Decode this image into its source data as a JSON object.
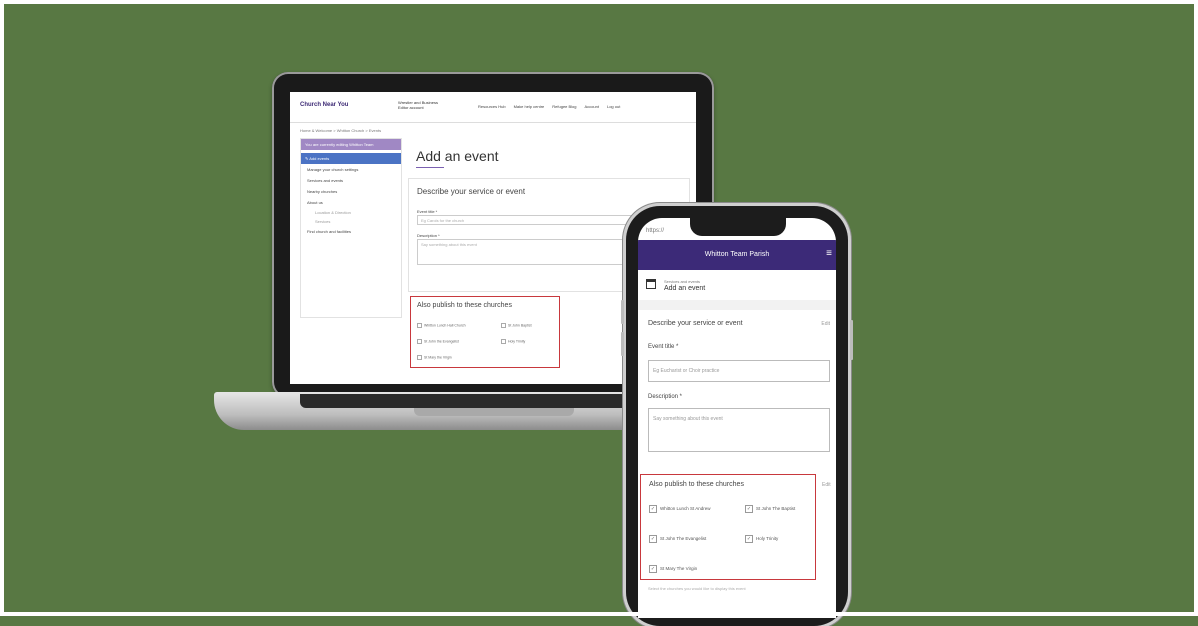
{
  "laptop": {
    "header": {
      "logo": "Church Near You",
      "church_line1": "Wrestler and Business",
      "church_line2": "Editor account",
      "nav": [
        "Resources Hub",
        "Make help centre",
        "Refugee Blog",
        "Account",
        "Log out"
      ]
    },
    "breadcrumb": "Home & Welcome > Whitton Church > Events",
    "sidebar": {
      "header": "You are currently editing Whitton Team",
      "active": "Add events",
      "items": [
        "Manage your church settings",
        "Services and events",
        "Nearby churches",
        "About us"
      ],
      "subitems": [
        "Location & Direction",
        "Services"
      ],
      "last": "Find church and facilities"
    },
    "page_title": "Add an event",
    "card": {
      "title": "Describe your service or event",
      "event_title_label": "Event title *",
      "event_title_placeholder": "Eg Carols for the church",
      "description_label": "Description *",
      "description_placeholder": "Say something about this event"
    },
    "publish": {
      "title": "Also publish to these churches",
      "churches": [
        "Whitton Lunch Hall Church",
        "St John Baptist",
        "St John the Evangelist",
        "Holy Trinity",
        "St Mary the Virgin"
      ]
    }
  },
  "phone": {
    "url": "https://",
    "header_title": "Whitton Team Parish",
    "menu_icon": "menu-icon",
    "sub_small": "Services and events",
    "sub_title": "Add an event",
    "section_title": "Describe your service or event",
    "section_edit": "Edit",
    "event_title_label": "Event title *",
    "event_title_placeholder": "Eg Eucharist or Choir practice",
    "description_label": "Description *",
    "description_placeholder": "Say something about this event",
    "publish": {
      "title": "Also publish to these churches",
      "edit": "Edit",
      "churches": [
        "Whitton Lunch St Andrew",
        "St John The Baptist",
        "St John The Evangelist",
        "Holy Trinity",
        "St Mary The Virgin"
      ]
    },
    "footer_text": "Select the churches you would like to display this event"
  }
}
